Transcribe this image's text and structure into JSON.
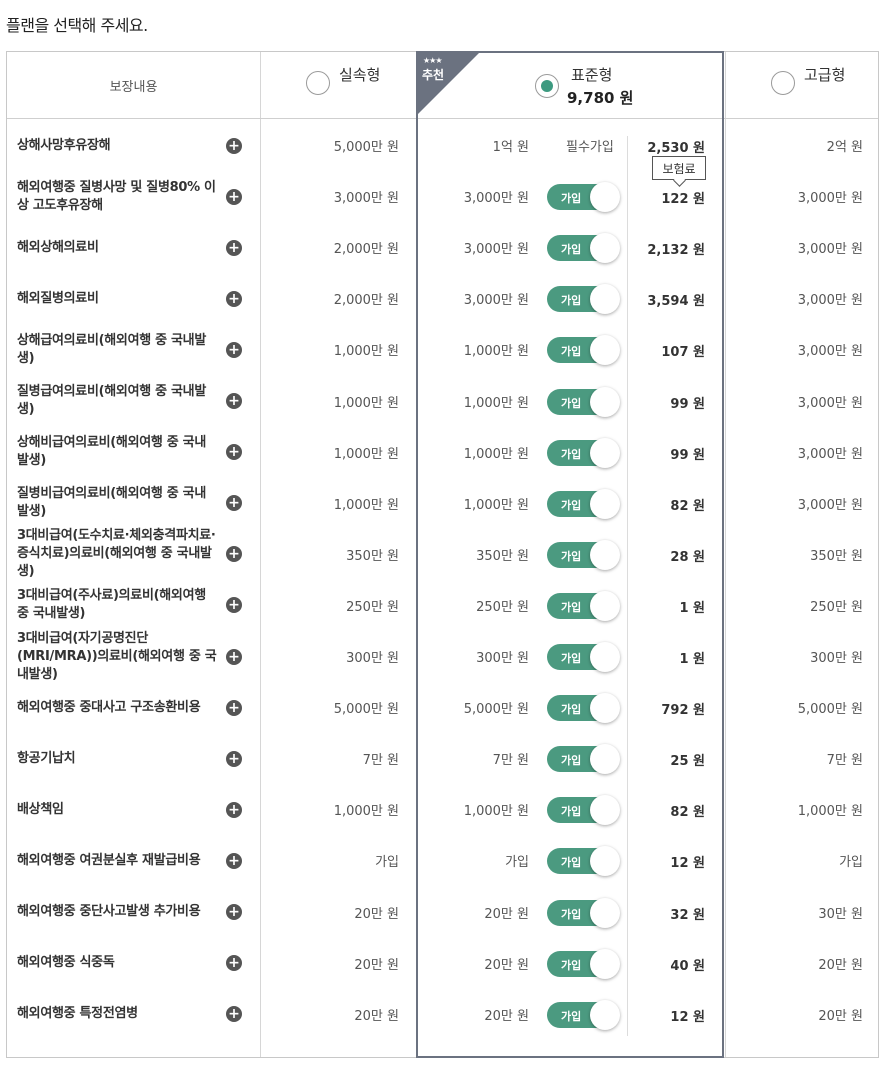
{
  "page": {
    "title": "플랜을 선택해 주세요."
  },
  "header": {
    "coverage_label": "보장내용",
    "badge_stars": "★★★",
    "badge_label": "추천",
    "premium_tooltip": "보험료",
    "plans": [
      {
        "key": "basic",
        "name": "실속형",
        "price": "",
        "selected": false
      },
      {
        "key": "standard",
        "name": "표준형",
        "price": "9,780 원",
        "selected": true
      },
      {
        "key": "premium",
        "name": "고급형",
        "price": "",
        "selected": false
      }
    ]
  },
  "colors": {
    "accent": "#4b9a80",
    "frame": "#6b7280"
  },
  "rows": [
    {
      "name": "상해사망후유장해",
      "basic": "5,000만 원",
      "standard": "1억 원",
      "join": "필수가입",
      "premium": "2,530 원",
      "advanced": "2억 원"
    },
    {
      "name": "해외여행중 질병사망 및 질병80% 이상 고도후유장해",
      "basic": "3,000만 원",
      "standard": "3,000만 원",
      "join": "가입",
      "premium": "122 원",
      "advanced": "3,000만 원"
    },
    {
      "name": "해외상해의료비",
      "basic": "2,000만 원",
      "standard": "3,000만 원",
      "join": "가입",
      "premium": "2,132 원",
      "advanced": "3,000만 원"
    },
    {
      "name": "해외질병의료비",
      "basic": "2,000만 원",
      "standard": "3,000만 원",
      "join": "가입",
      "premium": "3,594 원",
      "advanced": "3,000만 원"
    },
    {
      "name": "상해급여의료비(해외여행 중 국내발생)",
      "basic": "1,000만 원",
      "standard": "1,000만 원",
      "join": "가입",
      "premium": "107 원",
      "advanced": "3,000만 원"
    },
    {
      "name": "질병급여의료비(해외여행 중 국내발생)",
      "basic": "1,000만 원",
      "standard": "1,000만 원",
      "join": "가입",
      "premium": "99 원",
      "advanced": "3,000만 원"
    },
    {
      "name": "상해비급여의료비(해외여행 중 국내발생)",
      "basic": "1,000만 원",
      "standard": "1,000만 원",
      "join": "가입",
      "premium": "99 원",
      "advanced": "3,000만 원"
    },
    {
      "name": "질병비급여의료비(해외여행 중 국내발생)",
      "basic": "1,000만 원",
      "standard": "1,000만 원",
      "join": "가입",
      "premium": "82 원",
      "advanced": "3,000만 원"
    },
    {
      "name": "3대비급여(도수치료·체외충격파치료·증식치료)의료비(해외여행 중 국내발생)",
      "basic": "350만 원",
      "standard": "350만 원",
      "join": "가입",
      "premium": "28 원",
      "advanced": "350만 원"
    },
    {
      "name": "3대비급여(주사료)의료비(해외여행 중 국내발생)",
      "basic": "250만 원",
      "standard": "250만 원",
      "join": "가입",
      "premium": "1 원",
      "advanced": "250만 원"
    },
    {
      "name": "3대비급여(자기공명진단(MRI/MRA))의료비(해외여행 중 국내발생)",
      "basic": "300만 원",
      "standard": "300만 원",
      "join": "가입",
      "premium": "1 원",
      "advanced": "300만 원"
    },
    {
      "name": "해외여행중 중대사고 구조송환비용",
      "basic": "5,000만 원",
      "standard": "5,000만 원",
      "join": "가입",
      "premium": "792 원",
      "advanced": "5,000만 원"
    },
    {
      "name": "항공기납치",
      "basic": "7만 원",
      "standard": "7만 원",
      "join": "가입",
      "premium": "25 원",
      "advanced": "7만 원"
    },
    {
      "name": "배상책임",
      "basic": "1,000만 원",
      "standard": "1,000만 원",
      "join": "가입",
      "premium": "82 원",
      "advanced": "1,000만 원"
    },
    {
      "name": "해외여행중 여권분실후 재발급비용",
      "basic": "가입",
      "standard": "가입",
      "join": "가입",
      "premium": "12 원",
      "advanced": "가입"
    },
    {
      "name": "해외여행중 중단사고발생 추가비용",
      "basic": "20만 원",
      "standard": "20만 원",
      "join": "가입",
      "premium": "32 원",
      "advanced": "30만 원"
    },
    {
      "name": "해외여행중 식중독",
      "basic": "20만 원",
      "standard": "20만 원",
      "join": "가입",
      "premium": "40 원",
      "advanced": "20만 원"
    },
    {
      "name": "해외여행중 특정전염병",
      "basic": "20만 원",
      "standard": "20만 원",
      "join": "가입",
      "premium": "12 원",
      "advanced": "20만 원"
    }
  ]
}
